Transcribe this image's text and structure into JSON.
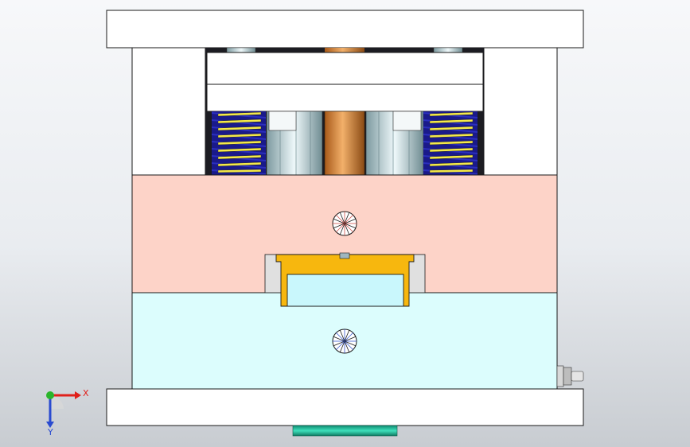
{
  "viewport": {
    "background_top": "#f7f8fa",
    "background_bottom": "#c8ccd1"
  },
  "model": {
    "plates": {
      "top_clamp_color": "#ffffff",
      "support_block_color": "#ffffff",
      "ejector_plate_color": "#ffffff",
      "cavity_plate_color": "#fdd3c8",
      "core_plate_color": "#dcfdfd",
      "bottom_clamp_color": "#ffffff",
      "outline_color": "#1a1a1a"
    },
    "springs": {
      "colors": [
        "#2b2fbf",
        "#f4e94a"
      ]
    },
    "sprue_color": "#d0823a",
    "part_color": "#f7b70e",
    "insert_color": "#c9f7fc",
    "locating_ring_color": "#1fbf9a",
    "cooling_fitting_color": "#c8c8c8"
  },
  "triad": {
    "x_label": "X",
    "y_label": "Y",
    "x_color": "#e0201a",
    "y_color": "#2ab52a",
    "z_color": "#2a4bd0",
    "icon": "coordinate-triad-icon"
  }
}
